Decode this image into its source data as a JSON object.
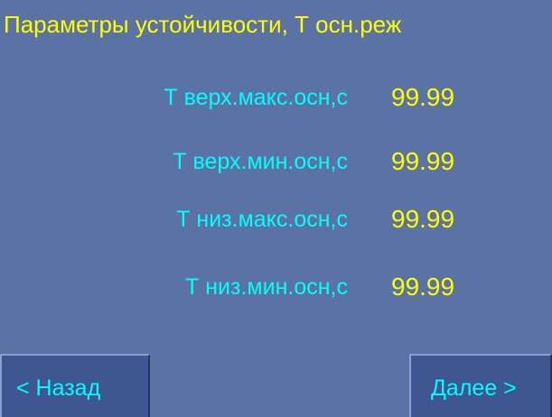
{
  "screen": {
    "title": "Параметры устойчивости, Т осн.реж"
  },
  "parameters": [
    {
      "label": "Т верх.макс.осн,с",
      "value": "99.99"
    },
    {
      "label": "Т верх.мин.осн,с",
      "value": "99.99"
    },
    {
      "label": "Т низ.макс.осн,с",
      "value": "99.99"
    },
    {
      "label": "Т низ.мин.осн,с",
      "value": "99.99"
    }
  ],
  "navigation": {
    "back_label": "< Назад",
    "next_label": "Далее >"
  },
  "colors": {
    "background": "#5b72a4",
    "title": "#ffff00",
    "label": "#00ffff",
    "value": "#ffff00",
    "button": "#3e5691"
  }
}
